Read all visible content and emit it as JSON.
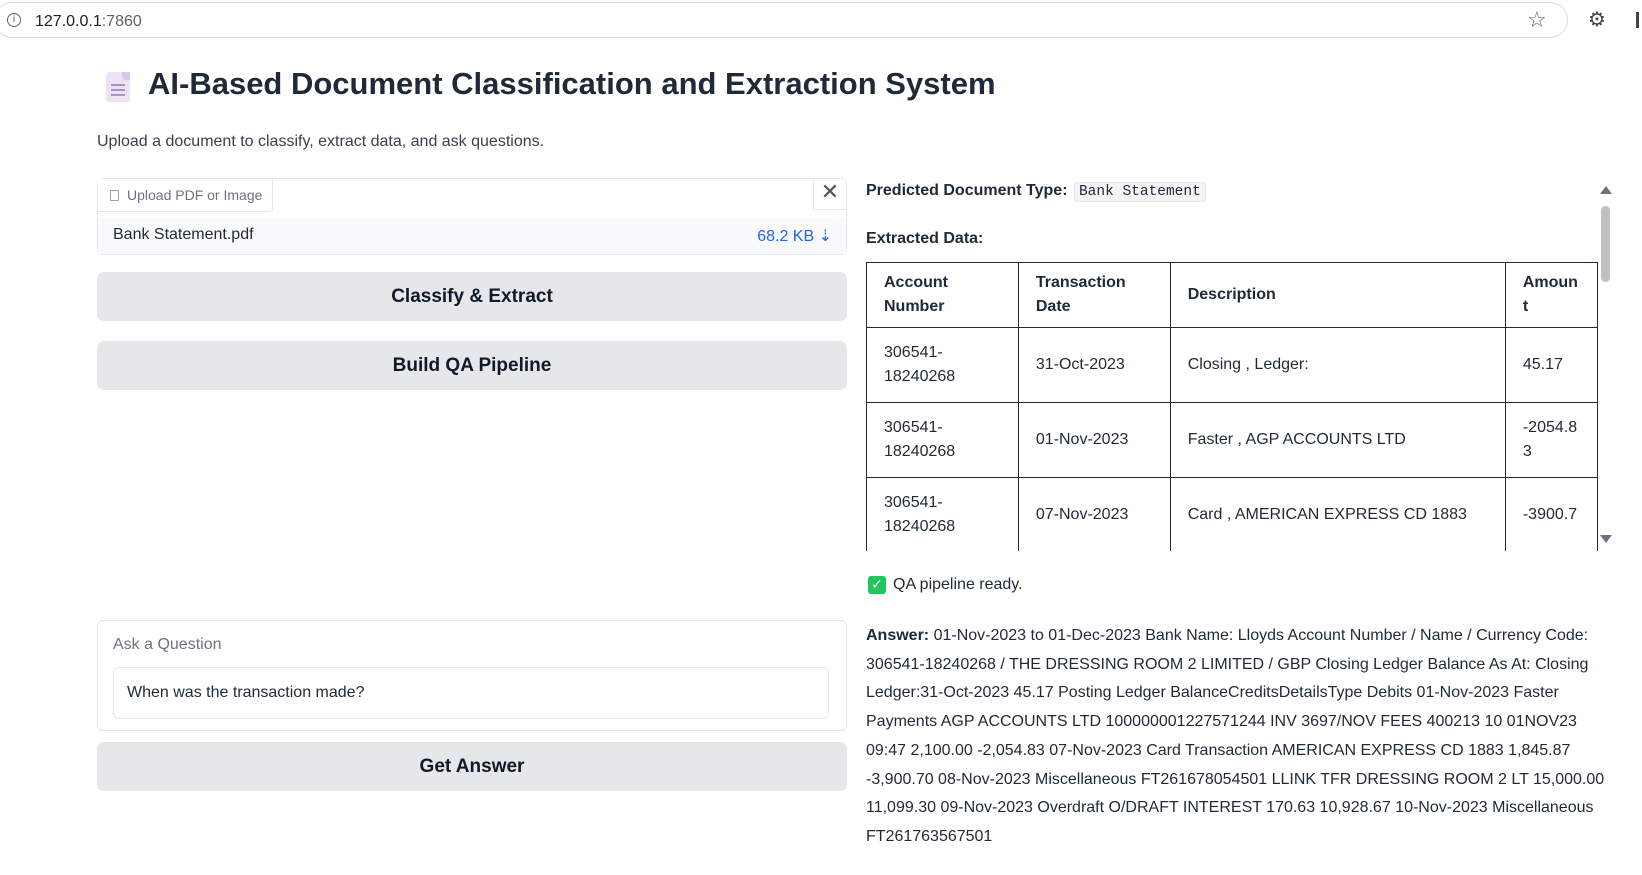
{
  "browser": {
    "url_host": "127.0.0.1",
    "url_port": ":7860",
    "info_icon": "i",
    "bookmark_icon": "star-outline-icon",
    "extensions_icon": "puzzle-icon"
  },
  "header": {
    "icon": "document-icon",
    "title": "AI-Based Document Classification and Extraction System",
    "subtitle": "Upload a document to classify, extract data, and ask questions."
  },
  "upload": {
    "label": "Upload PDF or Image",
    "close_glyph": "✕",
    "file_name": "Bank Statement.pdf",
    "file_size": "68.2 KB ⇣"
  },
  "buttons": {
    "classify": "Classify & Extract",
    "build_qa": "Build QA Pipeline",
    "get_answer": "Get Answer"
  },
  "question": {
    "label": "Ask a Question",
    "value": "When was the transaction made?"
  },
  "result": {
    "predicted_label": "Predicted Document Type:",
    "predicted_value": "Bank Statement",
    "extracted_label": "Extracted Data:",
    "table": {
      "headers": [
        "Account Number",
        "Transaction Date",
        "Description",
        "Amoun t"
      ],
      "rows": [
        [
          "306541- 18240268",
          "31-Oct-2023",
          "Closing , Ledger:",
          "45.17"
        ],
        [
          "306541- 18240268",
          "01-Nov-2023",
          "Faster , AGP ACCOUNTS LTD",
          "-2054.8 3"
        ],
        [
          "306541- 18240268",
          "07-Nov-2023",
          "Card , AMERICAN EXPRESS CD 1883",
          "-3900.7"
        ]
      ]
    }
  },
  "status": {
    "check": "✓",
    "text": "QA pipeline ready."
  },
  "answer": {
    "label": "Answer:",
    "text": " 01-Nov-2023 to 01-Dec-2023 Bank Name: Lloyds Account Number / Name / Currency Code: 306541-18240268 / THE DRESSING ROOM 2 LIMITED / GBP Closing Ledger Balance As At: Closing Ledger:31-Oct-2023 45.17 Posting Ledger BalanceCreditsDetailsType Debits 01-Nov-2023 Faster Payments AGP ACCOUNTS LTD 100000001227571244 INV 3697/NOV FEES 400213 10 01NOV23 09:47 2,100.00 -2,054.83 07-Nov-2023 Card Transaction AMERICAN EXPRESS CD 1883 1,845.87 -3,900.70 08-Nov-2023 Miscellaneous FT261678054501 LLINK TFR DRESSING ROOM 2 LT 15,000.00 11,099.30 09-Nov-2023 Overdraft O/DRAFT INTEREST 170.63 10,928.67 10-Nov-2023 Miscellaneous FT261763567501"
  }
}
